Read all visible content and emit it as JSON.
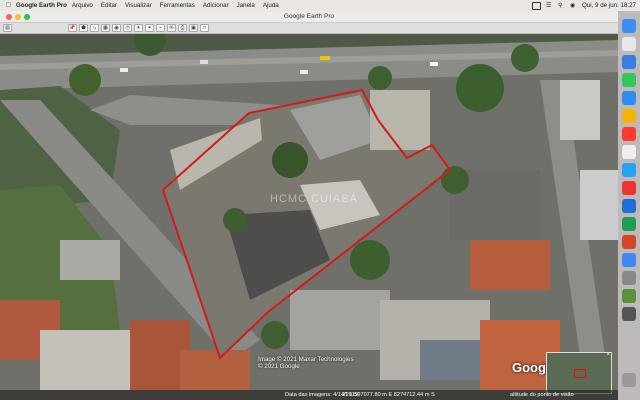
{
  "menubar": {
    "app_name": "Google Earth Pro",
    "items": [
      "Arquivo",
      "Editar",
      "Visualizar",
      "Ferramentas",
      "Adicionar",
      "Janela",
      "Ajuda"
    ],
    "clock": "Qui, 9 de jun.  18:27"
  },
  "window": {
    "title": "Google Earth Pro"
  },
  "map": {
    "watermark": "HCMC CUIABÁ",
    "credit_line1": "Image © 2021 Maxar Technologies",
    "credit_line2": "© 2021 Google",
    "google_logo": "Google"
  },
  "statusbar": {
    "imagery_date": "Data das imagens: 4/14/2019",
    "coordinates": "21 L  597077.80 m E  8274712.44 m S",
    "altitude": "altitude do ponto de visão  "
  },
  "colors": {
    "boundary": "#d41a1a",
    "menubar": "#e9e6e3",
    "titlebar": "#ececec"
  },
  "icons": {
    "apple": "apple-logo-icon",
    "tools": [
      "hide-sidebar-icon",
      "placemark-icon",
      "polygon-icon",
      "path-icon",
      "overlay-icon",
      "tour-icon",
      "historical-imagery-icon",
      "sun-icon",
      "planet-icon",
      "ruler-icon",
      "email-icon",
      "print-icon",
      "save-image-icon",
      "maps-icon"
    ]
  }
}
